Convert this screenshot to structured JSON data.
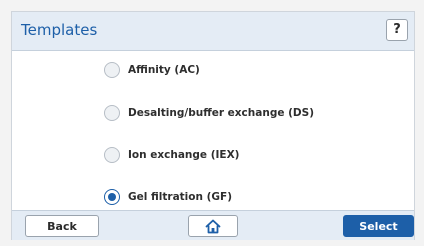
{
  "header": {
    "title": "Templates",
    "help_label": "?"
  },
  "options": [
    {
      "label": "Affinity (AC)",
      "selected": false
    },
    {
      "label": "Desalting/buffer exchange (DS)",
      "selected": false
    },
    {
      "label": "Ion exchange (IEX)",
      "selected": false
    },
    {
      "label": "Gel filtration (GF)",
      "selected": true
    }
  ],
  "footer": {
    "back_label": "Back",
    "home_icon": "home-icon",
    "select_label": "Select"
  },
  "colors": {
    "accent": "#1d5fa8",
    "header_bg": "#e4ecf5"
  }
}
